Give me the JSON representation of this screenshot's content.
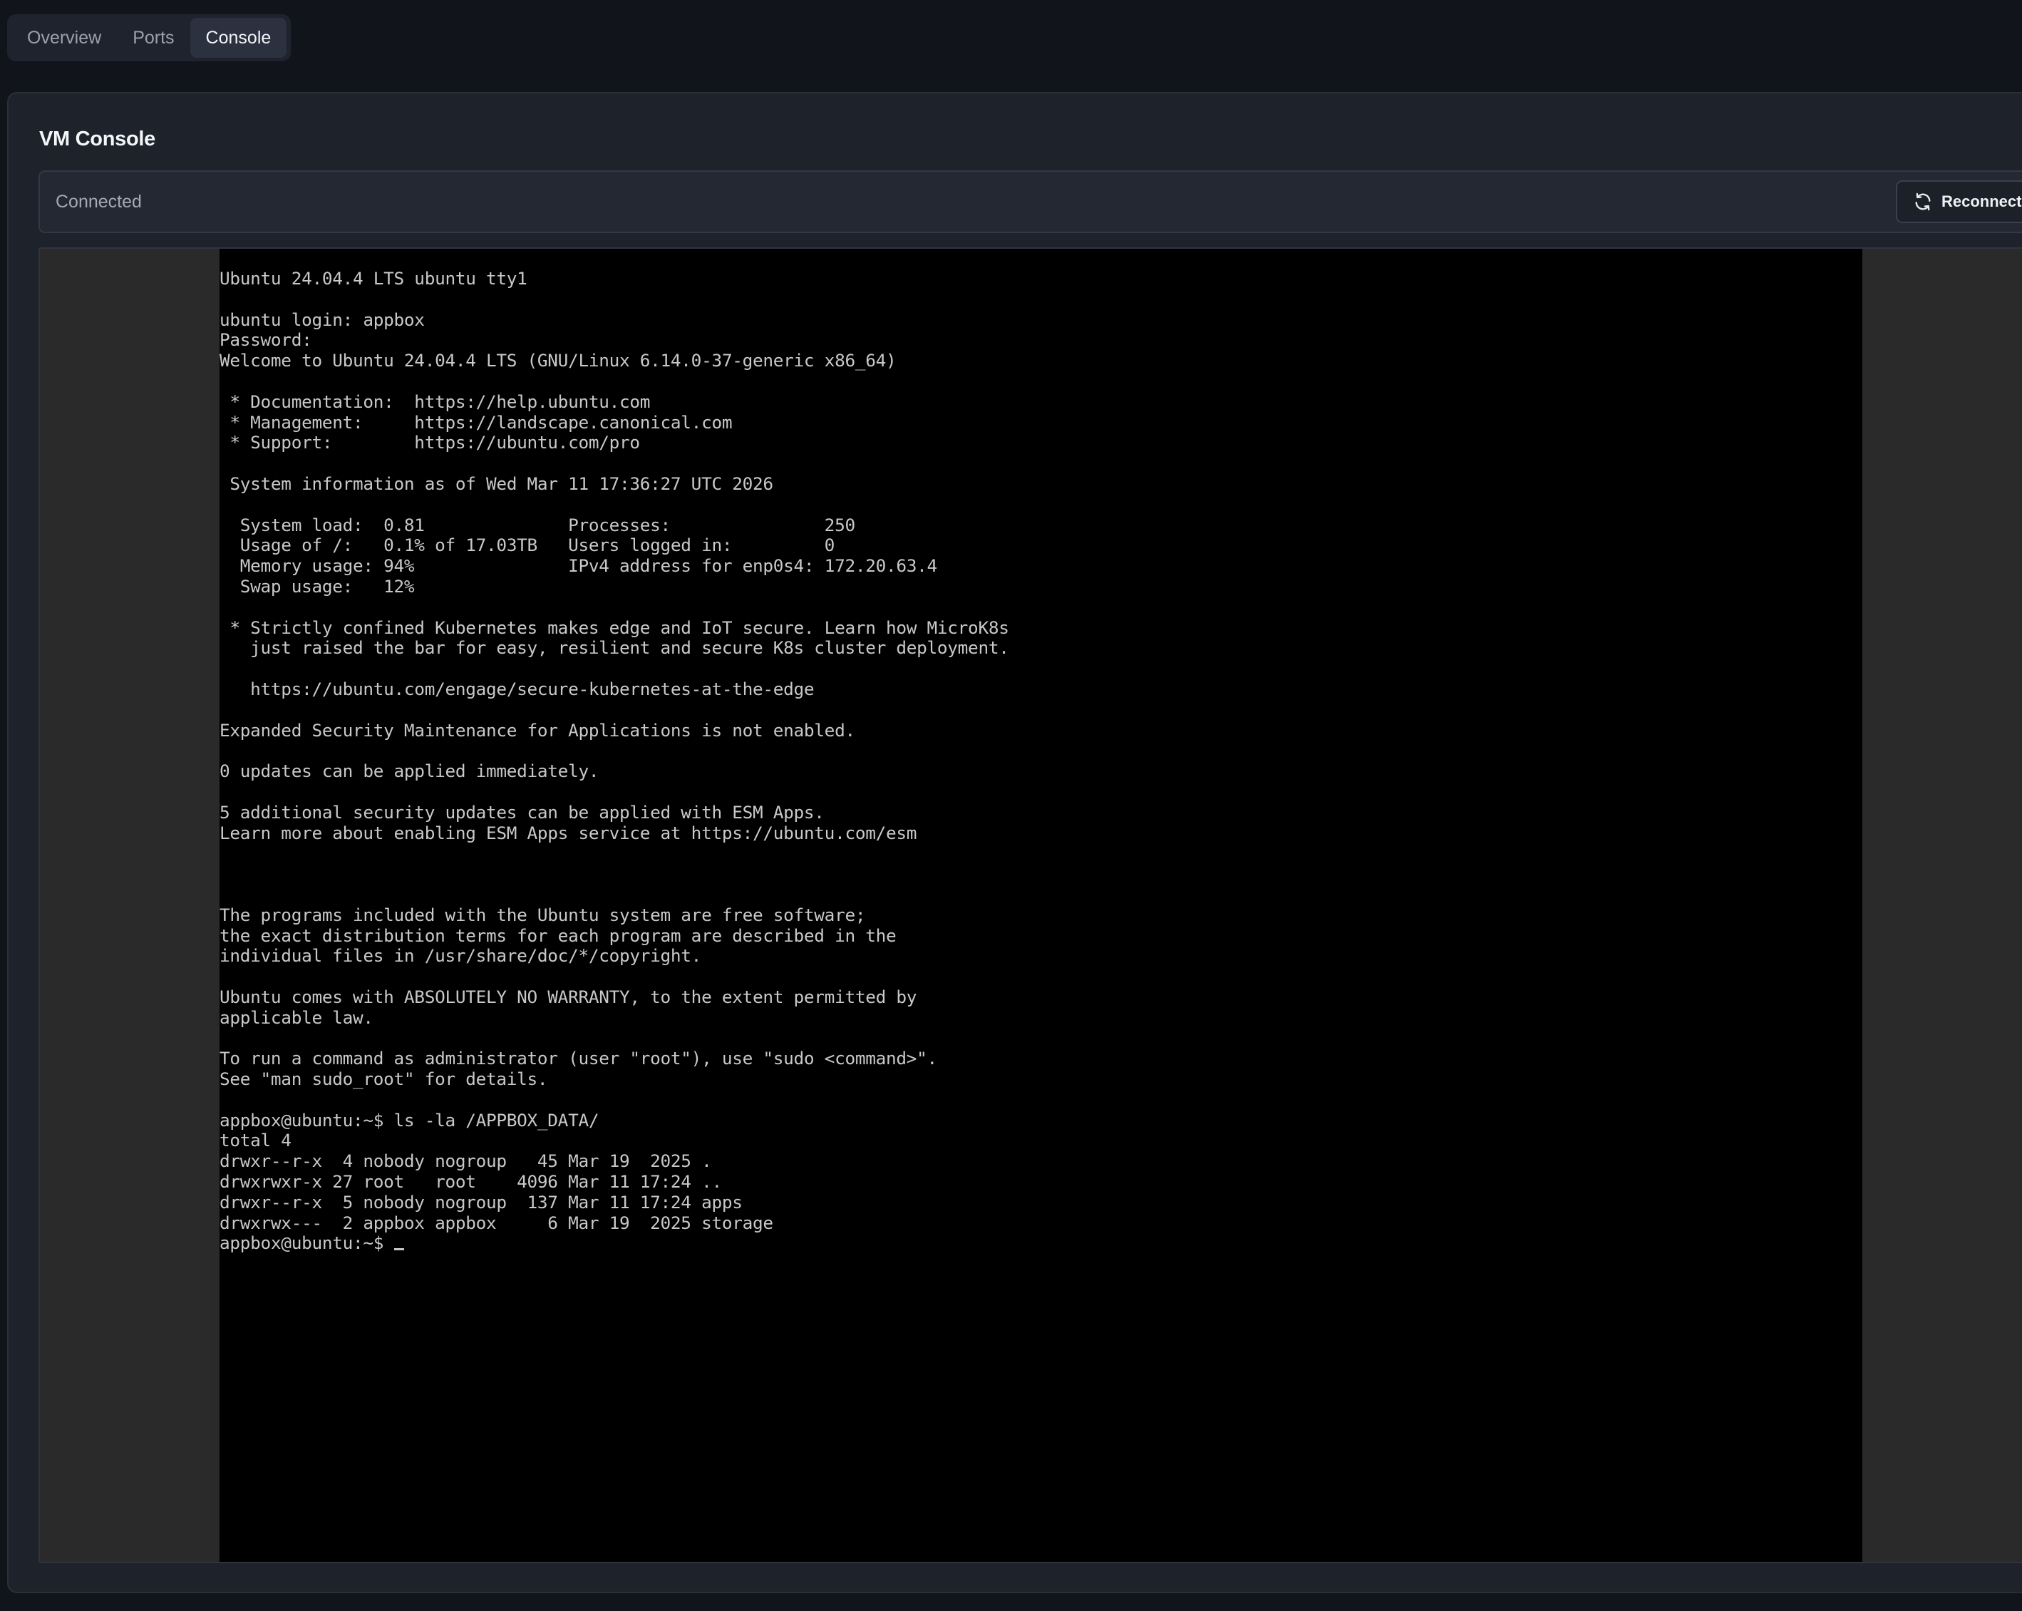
{
  "tabs": [
    {
      "label": "Overview",
      "active": false
    },
    {
      "label": "Ports",
      "active": false
    },
    {
      "label": "Console",
      "active": true
    }
  ],
  "console_card": {
    "title": "VM Console",
    "status": "Connected",
    "reconnect_label": "Reconnect",
    "reconnect_icon": "refresh-icon"
  },
  "terminal": {
    "lines": [
      "Ubuntu 24.04.4 LTS ubuntu tty1",
      "",
      "ubuntu login: appbox",
      "Password:",
      "Welcome to Ubuntu 24.04.4 LTS (GNU/Linux 6.14.0-37-generic x86_64)",
      "",
      " * Documentation:  https://help.ubuntu.com",
      " * Management:     https://landscape.canonical.com",
      " * Support:        https://ubuntu.com/pro",
      "",
      " System information as of Wed Mar 11 17:36:27 UTC 2026",
      "",
      "  System load:  0.81              Processes:               250",
      "  Usage of /:   0.1% of 17.03TB   Users logged in:         0",
      "  Memory usage: 94%               IPv4 address for enp0s4: 172.20.63.4",
      "  Swap usage:   12%",
      "",
      " * Strictly confined Kubernetes makes edge and IoT secure. Learn how MicroK8s",
      "   just raised the bar for easy, resilient and secure K8s cluster deployment.",
      "",
      "   https://ubuntu.com/engage/secure-kubernetes-at-the-edge",
      "",
      "Expanded Security Maintenance for Applications is not enabled.",
      "",
      "0 updates can be applied immediately.",
      "",
      "5 additional security updates can be applied with ESM Apps.",
      "Learn more about enabling ESM Apps service at https://ubuntu.com/esm",
      "",
      "",
      "",
      "The programs included with the Ubuntu system are free software;",
      "the exact distribution terms for each program are described in the",
      "individual files in /usr/share/doc/*/copyright.",
      "",
      "Ubuntu comes with ABSOLUTELY NO WARRANTY, to the extent permitted by",
      "applicable law.",
      "",
      "To run a command as administrator (user \"root\"), use \"sudo <command>\".",
      "See \"man sudo_root\" for details.",
      "",
      "appbox@ubuntu:~$ ls -la /APPBOX_DATA/",
      "total 4",
      "drwxr--r-x  4 nobody nogroup   45 Mar 19  2025 .",
      "drwxrwxr-x 27 root   root    4096 Mar 11 17:24 ..",
      "drwxr--r-x  5 nobody nogroup  137 Mar 11 17:24 apps",
      "drwxrwx---  2 appbox appbox     6 Mar 19  2025 storage"
    ],
    "prompt": "appbox@ubuntu:~$ "
  }
}
